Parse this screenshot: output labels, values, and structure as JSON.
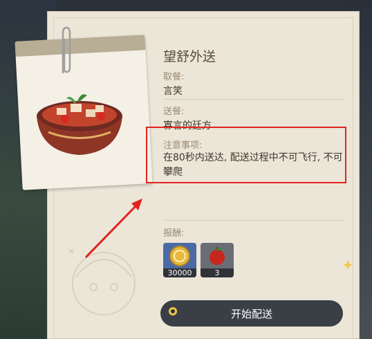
{
  "delivery": {
    "title": "望舒外送",
    "pickup_label": "取餐:",
    "pickup_value": "言笑",
    "deliver_label": "送餐:",
    "deliver_value": "寡言的廷方",
    "notes_label": "注意事项:",
    "notes_text": "在80秒内送达, 配送过程中不可飞行, 不可攀爬",
    "reward_label": "报酬:",
    "rewards": [
      {
        "name": "mora",
        "icon": "mora-coin-icon",
        "count": "30000"
      },
      {
        "name": "sunsettia",
        "icon": "sunsettia-icon",
        "count": "3"
      }
    ],
    "start_button": "开始配送"
  },
  "colors": {
    "highlight": "#e0231d",
    "panel": "#ece6d8",
    "button": "#3a3f46",
    "button_ring": "#f0c84a"
  }
}
